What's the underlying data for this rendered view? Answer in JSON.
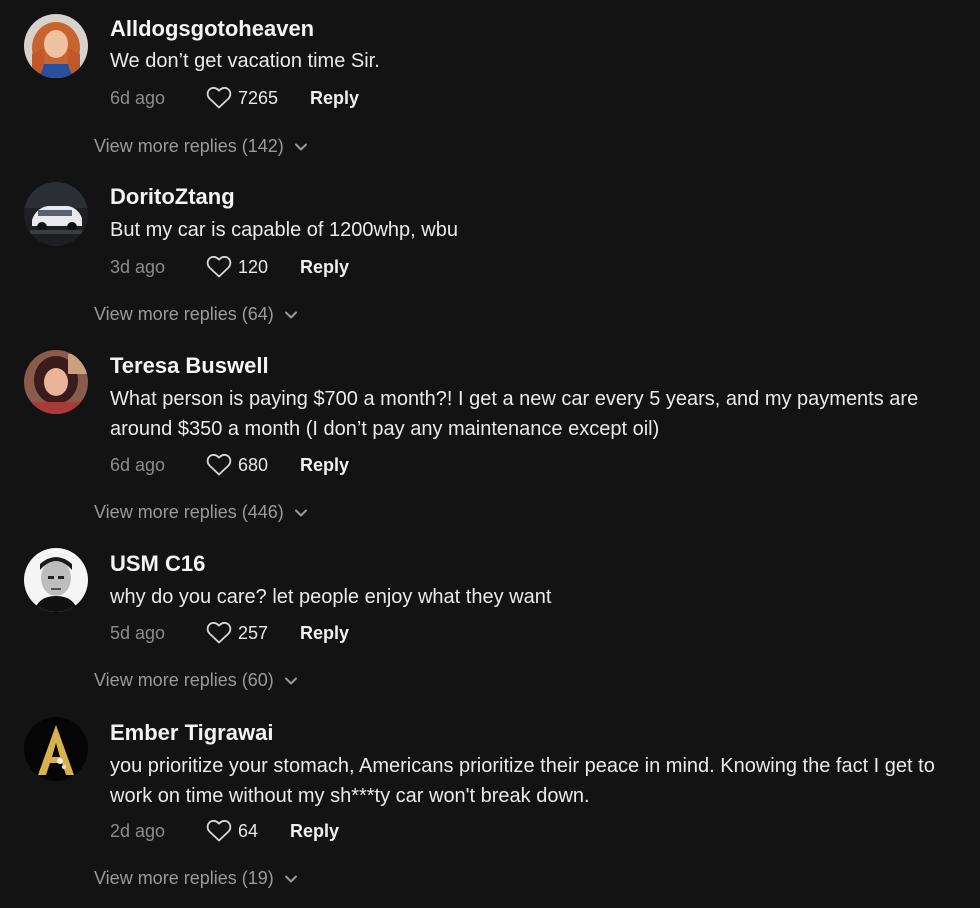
{
  "comments": [
    {
      "username": "Alldogsgotoheaven",
      "text": "We don’t get vacation time Sir.",
      "time": "6d ago",
      "likes": "7265",
      "reply_label": "Reply",
      "more_replies": "View more replies (142)"
    },
    {
      "username": "DoritoZtang",
      "text": "But my car is capable of 1200whp, wbu",
      "time": "3d ago",
      "likes": "120",
      "reply_label": "Reply",
      "more_replies": "View more replies (64)"
    },
    {
      "username": "Teresa Buswell",
      "text": "What person is paying $700 a month?! I get a new car every 5 years, and my payments are around $350 a month (I don’t pay any maintenance except oil)",
      "time": "6d ago",
      "likes": "680",
      "reply_label": "Reply",
      "more_replies": "View more replies (446)"
    },
    {
      "username": "USM C16",
      "text": "why do you care? let people enjoy what they want",
      "time": "5d ago",
      "likes": "257",
      "reply_label": "Reply",
      "more_replies": "View more replies (60)"
    },
    {
      "username": "Ember Tigrawai",
      "text": "you prioritize your stomach, Americans prioritize their peace in mind. Knowing the fact I get to work on time without my sh***ty car won't break down.",
      "time": "2d ago",
      "likes": "64",
      "reply_label": "Reply",
      "more_replies": "View more replies (19)"
    }
  ],
  "icons": {
    "like": "heart-outline-icon",
    "expand": "chevron-down-icon"
  },
  "colors": {
    "background": "#131313",
    "username": "#f4f4f4",
    "muted": "#8c8c8c"
  }
}
